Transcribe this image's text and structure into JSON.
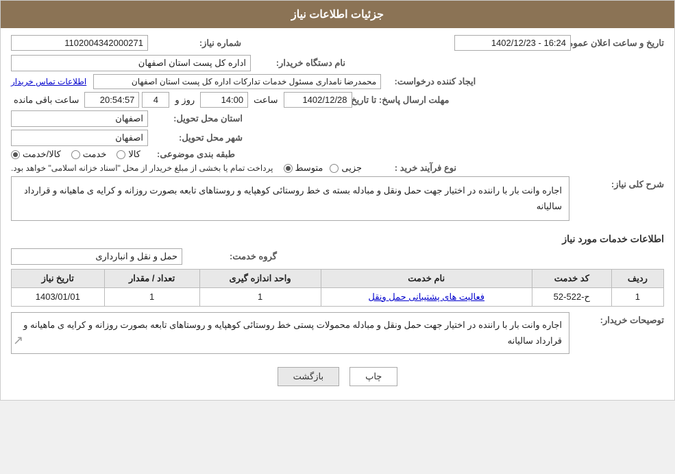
{
  "header": {
    "title": "جزئیات اطلاعات نیاز"
  },
  "fields": {
    "shomara_niaz_label": "شماره نیاز:",
    "shomara_niaz_value": "1102004342000271",
    "nam_dastgah_label": "نام دستگاه خریدار:",
    "nam_dastgah_value": "اداره کل پست استان اصفهان",
    "ijad_konandeh_label": "ایجاد کننده درخواست:",
    "ijad_konandeh_value": "محمدرضا نامداری مسئول خدمات تدارکات اداره کل پست استان اصفهان",
    "tamas_link": "اطلاعات تماس خریدار",
    "mohlat_label": "مهلت ارسال پاسخ: تا تاریخ:",
    "date_value": "1402/12/28",
    "saat_label": "ساعت",
    "saat_value": "14:00",
    "roz_label": "روز و",
    "roz_value": "4",
    "baqi_label": "ساعت باقی مانده",
    "baqi_value": "20:54:57",
    "ostan_tahvil_label": "استان محل تحویل:",
    "ostan_tahvil_value": "اصفهان",
    "shahr_tahvil_label": "شهر محل تحویل:",
    "shahr_tahvil_value": "اصفهان",
    "tarikhe_label": "تاریخ و ساعت اعلان عمومی:",
    "tarikhe_value": "1402/12/23 - 16:24",
    "tabaqebandi_label": "طبقه بندی موضوعی:",
    "kala_label": "کالا",
    "khadamat_label": "خدمت",
    "kala_khadamat_label": "کالا/خدمت",
    "navoe_farayand_label": "نوع فرآیند خرید :",
    "jozii_label": "جزیی",
    "motavasset_label": "متوسط",
    "pardakht_text": "پرداخت تمام یا بخشی از مبلغ خریدار از محل \"اسناد خزانه اسلامی\" خواهد بود.",
    "sharh_label": "شرح کلی نیاز:",
    "sharh_value": "اجاره وانت بار با راننده در اختیار جهت حمل ونقل و مبادله بسته ی خط روستائی کوهپایه و روستاهای تابعه بصورت روزانه و کرایه ی ماهیانه و قرارداد سالیانه",
    "ettelaat_label": "اطلاعات خدمات مورد نیاز",
    "goroh_label": "گروه خدمت:",
    "goroh_value": "حمل و نقل و انبارداری",
    "table_headers": [
      "ردیف",
      "کد خدمت",
      "نام خدمت",
      "واحد اندازه گیری",
      "تعداد / مقدار",
      "تاریخ نیاز"
    ],
    "table_rows": [
      {
        "radif": "1",
        "kod_khadamat": "ح-522-52",
        "nam_khadamat": "فعالیت های پشتیبانی حمل ونقل",
        "vahed": "1",
        "tedad": "1",
        "tarikh": "1403/01/01"
      }
    ],
    "tvsifat_label": "توصیحات خریدار:",
    "tvsifat_value": "اجاره وانت بار با راننده در اختیار جهت حمل ونقل و مبادله محمولات  پستی خط روستائی کوهپایه و روستاهای تابعه بصورت روزانه و کرایه ی ماهیانه و قرارداد سالیانه",
    "btn_chap": "چاپ",
    "btn_bazgasht": "بازگشت"
  }
}
